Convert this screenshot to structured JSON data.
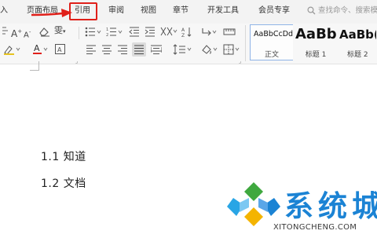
{
  "menu": {
    "tabs": [
      {
        "label": "入"
      },
      {
        "label": "页面布局"
      },
      {
        "label": "引用"
      },
      {
        "label": "审阅"
      },
      {
        "label": "视图"
      },
      {
        "label": "章节"
      },
      {
        "label": "开发工具"
      },
      {
        "label": "会员专享"
      }
    ],
    "highlighted_tab": "引用",
    "search_placeholder": "查找命令、搜索模"
  },
  "ribbon": {
    "font_grow": "A",
    "font_shrink": "A",
    "phonetic": "雯",
    "styles": [
      {
        "sample": "AaBbCcDd",
        "name": "正文"
      },
      {
        "sample": "AaBb",
        "name": "标题 1"
      },
      {
        "sample": "AaBb(",
        "name": "标题 2"
      }
    ]
  },
  "document": {
    "headings": [
      "1.1 知道",
      "1.2 文档"
    ]
  },
  "watermark": {
    "text": "系统城",
    "url": "XITONGCHENG.COM"
  },
  "colors": {
    "accent_red": "#e0201a",
    "watermark_blue": "#1b83d4"
  }
}
